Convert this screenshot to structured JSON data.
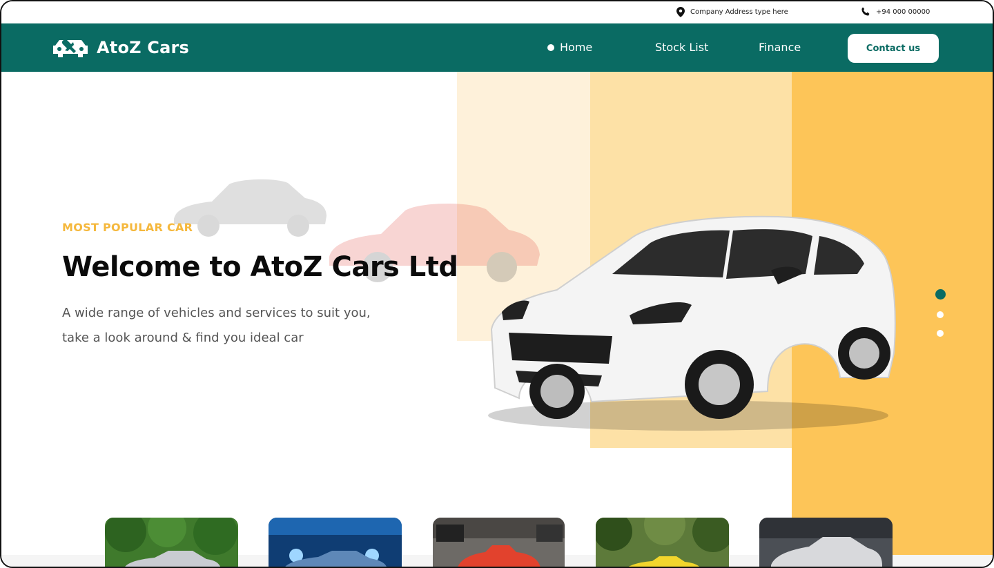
{
  "topbar": {
    "address": "Company Address type here",
    "phone": "+94 000 00000",
    "address_icon": "location-pin-icon",
    "phone_icon": "phone-icon"
  },
  "brand": {
    "name": "AtoZ Cars",
    "logo_icon": "car-wrench-icon"
  },
  "nav": {
    "items": [
      {
        "label": "Home"
      },
      {
        "label": "Stock List"
      },
      {
        "label": "Finance"
      }
    ],
    "cta": "Contact us"
  },
  "hero": {
    "eyebrow": "MOST POPULAR CAR",
    "title": "Welcome to AtoZ Cars Ltd",
    "subtitle_line1": "A wide range of vehicles and services to suit you,",
    "subtitle_line2": "take a look around & find you ideal car",
    "slider_active": 0,
    "slider_count": 3
  },
  "thumbnails": [
    {
      "name": "thumb-silver-sedan"
    },
    {
      "name": "thumb-blue-sedan"
    },
    {
      "name": "thumb-red-sportscar"
    },
    {
      "name": "thumb-yellow-sportscar"
    },
    {
      "name": "thumb-white-coupe"
    }
  ],
  "colors": {
    "brand_teal": "#0a6b63",
    "accent_yellow": "#fdc558",
    "eyebrow": "#f5b83d"
  }
}
